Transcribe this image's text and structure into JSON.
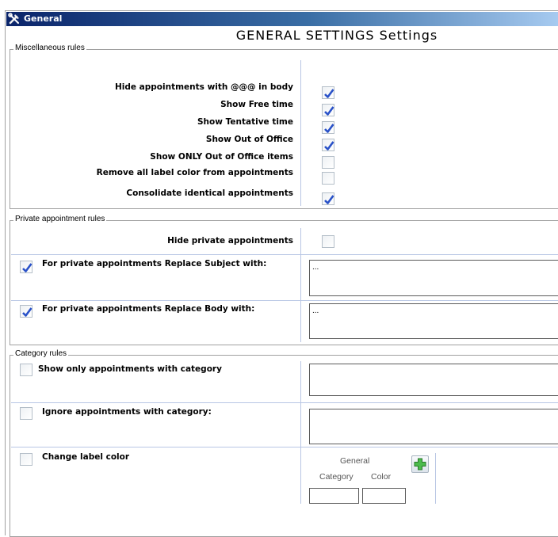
{
  "window": {
    "tab_title": "General",
    "heading": "GENERAL SETTINGS Settings"
  },
  "misc": {
    "legend": "Miscellaneous rules",
    "rows": [
      {
        "label": "Hide appointments with @@@ in body",
        "checked": true
      },
      {
        "label": "Show Free time",
        "checked": true
      },
      {
        "label": "Show Tentative time",
        "checked": true
      },
      {
        "label": "Show Out of Office",
        "checked": true
      },
      {
        "label": "Show ONLY Out of Office items",
        "checked": false
      },
      {
        "label": "Remove all label color from appointments",
        "checked": false
      },
      {
        "label": "Consolidate identical appointments",
        "checked": true
      }
    ]
  },
  "private": {
    "legend": "Private appointment rules",
    "hide_label": "Hide private appointments",
    "hide_checked": false,
    "subject_label": "For private appointments Replace Subject with:",
    "subject_checked": true,
    "subject_value": "...",
    "body_label": "For private appointments Replace Body with:",
    "body_checked": true,
    "body_value": "..."
  },
  "category": {
    "legend": "Category rules",
    "show_only_label": "Show only appointments with category",
    "show_only_checked": false,
    "show_only_value": "",
    "ignore_label": "Ignore appointments with category:",
    "ignore_checked": false,
    "ignore_value": "",
    "change_color_label": "Change label color",
    "change_color_checked": false,
    "color_table": {
      "group_header": "General",
      "col_category": "Category",
      "col_color": "Color"
    }
  },
  "icons": {
    "title_icon": "tools-icon",
    "check_icon": "checkmark-icon",
    "add_icon": "plus-icon"
  },
  "colors": {
    "title_start": "#0a246a",
    "title_end": "#a6caf0",
    "check": "#2a52c8",
    "plus": "#3aa63a"
  }
}
